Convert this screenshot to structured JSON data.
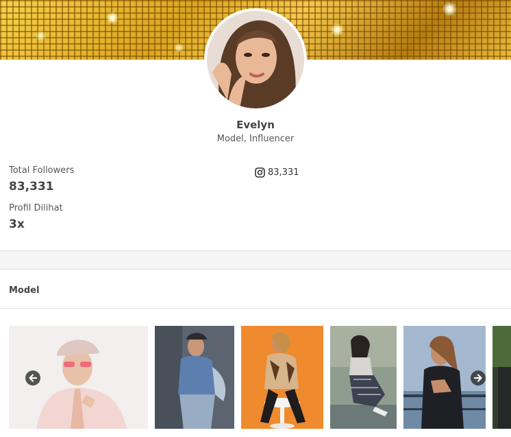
{
  "profile": {
    "name": "Evelyn",
    "role": "Model, Influencer"
  },
  "stats": {
    "followers_label": "Total Followers",
    "followers_value": "83,331",
    "views_label": "Profil Dilihat",
    "views_value": "3x"
  },
  "social": {
    "instagram_icon": "instagram-icon",
    "instagram_count": "83,331"
  },
  "section": {
    "title": "Model"
  },
  "gallery": {
    "prev_icon": "arrow-left-icon",
    "next_icon": "arrow-right-icon",
    "photos": [
      "model-photo-pink-blazer",
      "model-photo-denim-jacket",
      "model-photo-orange-chair",
      "model-photo-checked-pants",
      "model-photo-black-top",
      "model-photo-partial"
    ]
  },
  "colors": {
    "banner_gold": "#d9a520",
    "text_dark": "#444444",
    "divider": "#e3e3e3"
  }
}
